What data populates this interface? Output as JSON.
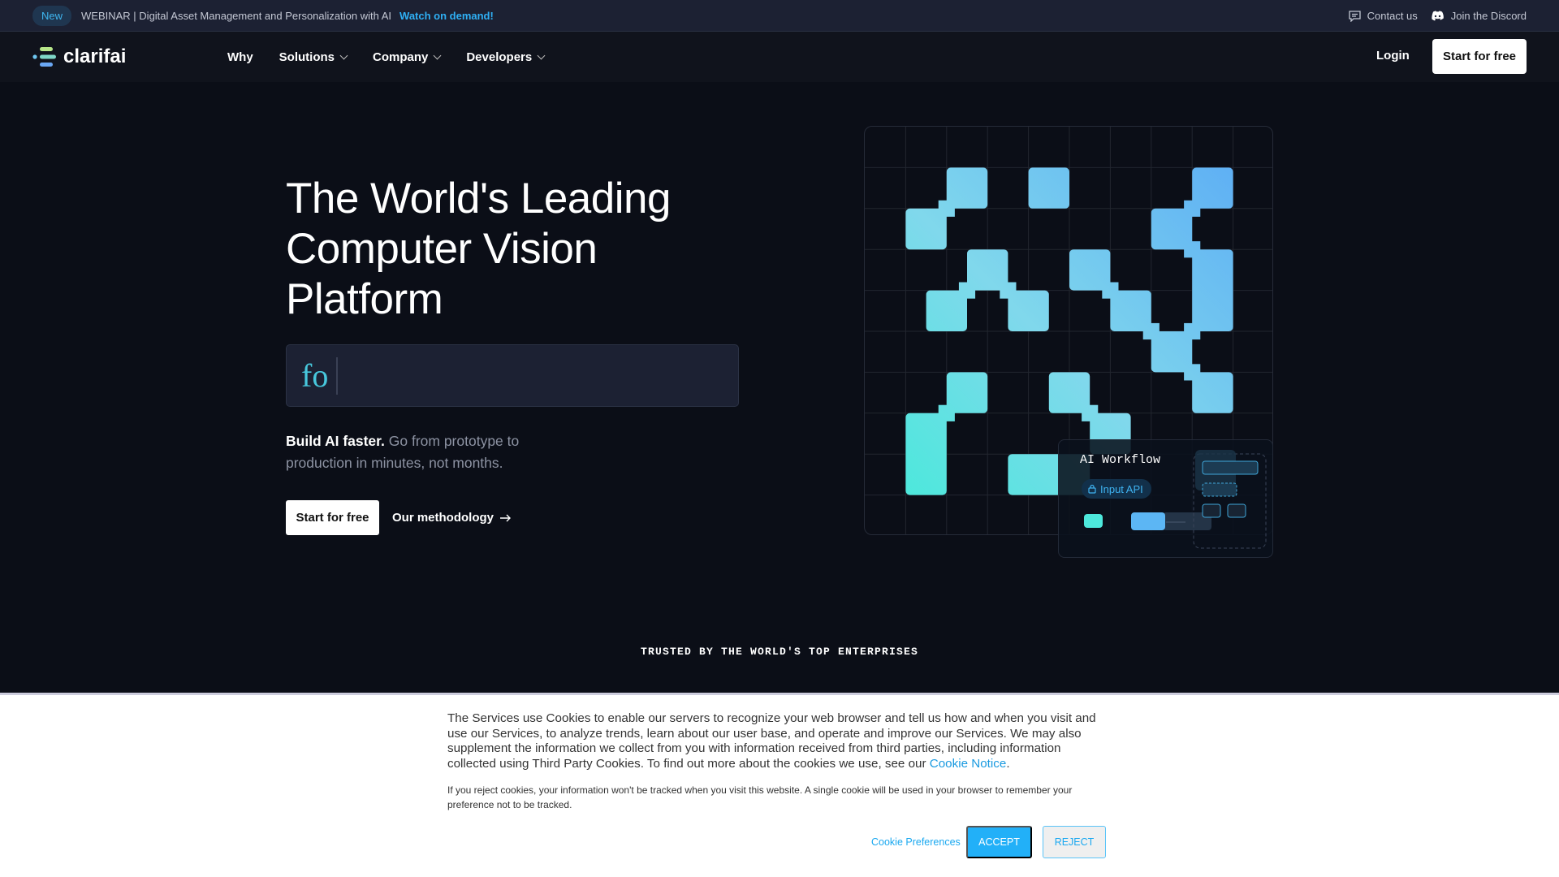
{
  "announcement": {
    "badge": "New",
    "text": "WEBINAR | Digital Asset Management and Personalization with AI",
    "link": "Watch on demand!",
    "contact": "Contact us",
    "discord": "Join the Discord"
  },
  "nav": {
    "brand": "clarifai",
    "items": [
      {
        "label": "Why"
      },
      {
        "label": "Solutions"
      },
      {
        "label": "Company"
      },
      {
        "label": "Developers"
      }
    ],
    "login": "Login",
    "cta": "Start for free"
  },
  "hero": {
    "title": "The World's Leading Computer Vision Platform",
    "typed": "fo",
    "lead_bold": "Build AI faster.",
    "lead_rest": " Go from prototype to production in minutes, not months.",
    "cta_primary": "Start for free",
    "cta_secondary": "Our methodology"
  },
  "workflow_card": {
    "title": "AI Workflow",
    "pill": "Input API"
  },
  "trusted": "TRUSTED BY THE WORLD'S TOP ENTERPRISES",
  "cookie": {
    "text": "The Services use Cookies to enable our servers to recognize your web browser and tell us how and when you visit and use our Services, to analyze trends, learn about our user base, and operate and improve our Services. We may also supplement the information we collect from you with information received from third parties, including information collected using Third Party Cookies. To find out more about the cookies we use, see our ",
    "link": "Cookie Notice",
    "period": ".",
    "small": "If you reject cookies, your information won't be tracked when you visit this website. A single cookie will be used in your browser to remember your preference not to be tracked.",
    "preferences": "Cookie Preferences",
    "accept": "ACCEPT",
    "reject": "REJECT"
  },
  "colors": {
    "accent": "#2fb0f5",
    "teal": "#4de8dc",
    "blue": "#5fb0f4",
    "accept": "#22b0f8"
  }
}
